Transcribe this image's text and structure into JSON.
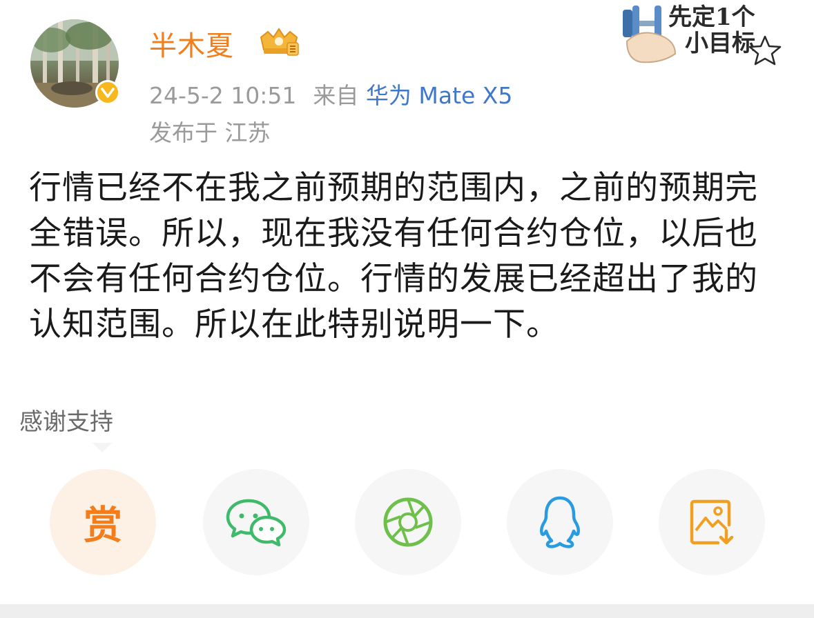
{
  "post": {
    "username": "半木夏",
    "date": "24-5-2 10:51",
    "source_prefix": "来自",
    "device": "华为 Mate X5",
    "location": "发布于 江苏",
    "text": "行情已经不在我之前预期的范围内，之前的预期完全错误。所以，现在我没有任何合约仓位，以后也不会有任何合约仓位。行情的发展已经超出了我的认知范围。所以在此特别说明一下。"
  },
  "sticker": {
    "line1": "先定1个",
    "line2": "小目标"
  },
  "support": {
    "label": "感谢支持",
    "reward_label": "赏"
  },
  "share_buttons": [
    {
      "name": "reward",
      "icon": "reward-icon"
    },
    {
      "name": "wechat",
      "icon": "wechat-icon"
    },
    {
      "name": "moments",
      "icon": "moments-icon"
    },
    {
      "name": "qq",
      "icon": "qq-icon"
    },
    {
      "name": "save-image",
      "icon": "save-image-icon"
    }
  ],
  "colors": {
    "username": "#f27d1a",
    "device_link": "#3f78c9",
    "meta": "#9a9a9a",
    "verified": "#f6b81c",
    "wechat": "#3fba6a",
    "moments": "#6ec04a",
    "qq": "#2b9be0",
    "save": "#f0a020"
  }
}
